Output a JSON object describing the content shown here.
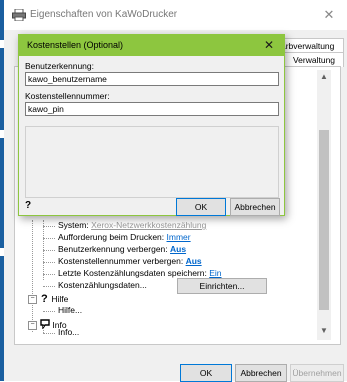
{
  "window": {
    "title": "Eigenschaften von KaWoDrucker",
    "close_glyph": "✕",
    "tabs": [
      "arbverwaltung",
      "Verwaltung"
    ]
  },
  "tree": {
    "items": [
      {
        "label": "System: ",
        "value": "Xerox-Netzwerkkostenzählung",
        "disabled": true
      },
      {
        "label": "Aufforderung beim Drucken: ",
        "value": "Immer"
      },
      {
        "label": "Benutzerkennung verbergen: ",
        "value": "Aus",
        "bold": true
      },
      {
        "label": "Kostenstellennummer verbergen: ",
        "value": "Aus",
        "bold": true
      },
      {
        "label": "Letzte Kostenzählungsdaten speichern: ",
        "value": "Ein"
      },
      {
        "label": "Kostenzählungsdaten...",
        "button": "Einrichten..."
      }
    ],
    "hilfe_group": "Hilfe",
    "hilfe_item": "Hilfe...",
    "info_group": "Info",
    "info_item": "Info...",
    "collapse_glyph": "−"
  },
  "scrollbar": {
    "up": "▲",
    "down": "▼"
  },
  "footer": {
    "ok": "OK",
    "cancel": "Abbrechen",
    "apply": "Übernehmen"
  },
  "dialog": {
    "title": "Kostenstellen (Optional)",
    "close_glyph": "✕",
    "user_label": "Benutzerkennung:",
    "user_value": "kawo_benutzername",
    "cost_label": "Kostenstellennummer:",
    "cost_value": "kawo_pin",
    "help_glyph": "?",
    "ok": "OK",
    "cancel": "Abbrechen"
  },
  "colors": {
    "dialog_accent": "#8dc63f",
    "link": "#0066cc"
  }
}
